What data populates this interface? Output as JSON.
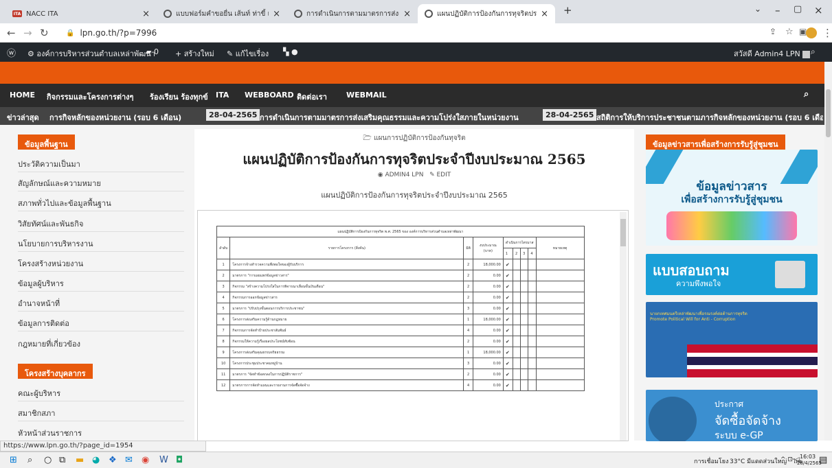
{
  "browser": {
    "tabs": [
      {
        "title": "NACC ITA"
      },
      {
        "title": "แบบฟอร์มคำขอยื่น เส้นท์ ท่าขี้ และรัล"
      },
      {
        "title": "การดำเนินการตามมาตรการส่งเสริมคุณ"
      },
      {
        "title": "แผนปฏิบัติการป้องกันการทุจริตประจำปี"
      }
    ],
    "url": "lpn.go.th/?p=7996",
    "status_url": "https://www.lpn.go.th/?page_id=1954"
  },
  "wpbar": {
    "site": "องค์การบริหารส่วนตำบลเหล่าพัฒนา",
    "comments": "0",
    "new": "สร้างใหม่",
    "edit": "แก้ไขเรื่อง",
    "greeting": "สวัสดี Admin4 LPN"
  },
  "menu": [
    "HOME",
    "กิจกรรมและโครงการต่างๆ",
    "ร้องเรียน ร้องทุกข์",
    "ITA",
    "WEBBOARD",
    "ติดต่อเรา",
    "WEBMAIL"
  ],
  "ticker": {
    "label": "ข่าวล่าสุด",
    "item1": "การกิจหลักของหน่วยงาน (รอบ 6 เดือน)",
    "date1": "28-04-2565",
    "item2": "การดำเนินการตามมาตรการส่งเสริมคุณธรรมและความโปร่งใสภายในหน่วยงาน",
    "date2": "28-04-2565",
    "item3": "สถิติการให้บริการประชาชนตามภารกิจหลักของหน่วยงาน (รอบ 6 เดือ"
  },
  "sidebar": {
    "head1": "ข้อมูลพื้นฐาน",
    "items": [
      "ประวัติความเป็นมา",
      "สัญลักษณ์และความหมาย",
      "สภาพทั่วไปและข้อมูลพื้นฐาน",
      "วิสัยทัศน์และพันธกิจ",
      "นโยบายการบริหารงาน",
      "โครงสร้างหน่วยงาน",
      "ข้อมูลผู้บริหาร",
      "อำนาจหน้าที่",
      "ข้อมูลการติดต่อ",
      "กฎหมายที่เกี่ยวข้อง"
    ],
    "head2": "โครงสร้างบุคลากร",
    "items2": [
      "คณะผู้บริหาร",
      "สมาชิกสภา",
      "หัวหน้าส่วนราชการ"
    ]
  },
  "post": {
    "category": "แผนการปฏิบัติการป้องกันทุจริต",
    "title": "แผนปฏิบัติการป้องกันการทุจริตประจำปีงบประมาณ 2565",
    "author": "ADMIN4 LPN",
    "edit": "EDIT",
    "subtitle": "แผนปฏิบัติการป้องกันการทุจริตประจำปีงบประมาณ 2565"
  },
  "doc_table": {
    "caption": "แผนปฏิบัติการป้องกันการทุจริต พ.ศ. 2565 ของ องค์การบริหารส่วนตำบลเหล่าพัฒนา",
    "headers": [
      "ลำดับ",
      "รายการโครงการ (สิ่งค้น)",
      "มิติ",
      "งบประมาณ (บาท)",
      "ดำเนินการไตรมาส",
      "หมายเหตุ"
    ],
    "quarters": [
      "1",
      "2",
      "3",
      "4"
    ],
    "rows": [
      [
        "1",
        "โครงการจ้างสำรวจความพึงพอใจของผู้รับบริการ",
        "2",
        "18,000.00"
      ],
      [
        "2",
        "มาตรการ \"การเผยแพร่ข้อมูลข่าวสาร\"",
        "2",
        "0.00"
      ],
      [
        "3",
        "กิจกรรม \"สร้างความโปร่งใสในการพิจารณาเลื่อนขั้นเงินเดือน\"",
        "2",
        "0.00"
      ],
      [
        "4",
        "กิจกรรมการออกข้อมูลข่าวสาร",
        "2",
        "0.00"
      ],
      [
        "5",
        "มาตรการ \"ปรับปรุงขั้นตอนการบริการประชาชน\"",
        "3",
        "0.00"
      ],
      [
        "6",
        "โครงการส่งเสริมความรู้ด้านกฎหมาย",
        "1",
        "18,000.00"
      ],
      [
        "7",
        "กิจกรรมการจัดทำป้ายประชาสัมพันธ์",
        "4",
        "0.00"
      ],
      [
        "8",
        "กิจกรรมให้ความรู้เรื่องผลประโยชน์ทับซ้อน",
        "2",
        "0.00"
      ],
      [
        "9",
        "โครงการส่งเสริมคุณธรรมจริยธรรม",
        "1",
        "18,000.00"
      ],
      [
        "10",
        "โครงการประชุมประชาคมหมู่บ้าน",
        "3",
        "0.00"
      ],
      [
        "11",
        "มาตรการ \"จัดทำข้อตกลงในการปฏิบัติราชการ\"",
        "2",
        "0.00"
      ],
      [
        "12",
        "มาตรการการจัดทำแผนและรายงานการจัดซื้อจัดจ้าง",
        "4",
        "0.00"
      ]
    ]
  },
  "right": {
    "head": "ข้อมูลข่าวสารเพื่อสร้างการรับรู้สู่ชุมชน",
    "banner1_line1": "ข้อมูลข่าวสาร",
    "banner1_line2": "เพื่อสร้างการรับรู้สู่ชุมชน",
    "banner2_line1": "แบบสอบถาม",
    "banner2_line2": "ความพึงพอใจ",
    "banner3_line1": "นายกเทศมนตรีเหล่าพัฒนาเพื่อรณรงค์ต่อต้านการทุจริต",
    "banner3_line2": "Promote Political Will for Anti - Corruption",
    "banner4_line1": "ประกาศ",
    "banner4_line2": "จัดซื้อจัดจ้าง",
    "banner4_line3": "ระบบ e-GP"
  },
  "taskbar": {
    "weather": "33°C มีแดดส่วนใหญ่",
    "time": "16:03",
    "date": "28/4/2565",
    "lang": "ไทย"
  }
}
